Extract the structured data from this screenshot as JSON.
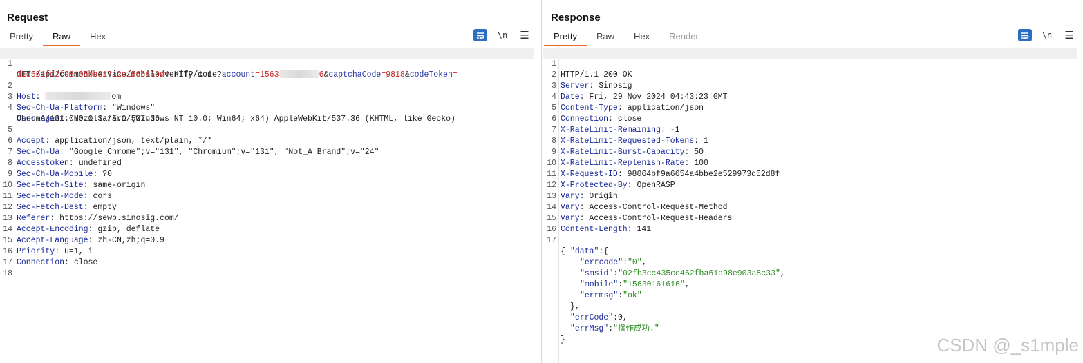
{
  "request": {
    "title": "Request",
    "tabs": [
      {
        "label": "Pretty",
        "active": false
      },
      {
        "label": "Raw",
        "active": true
      },
      {
        "label": "Hex",
        "active": false
      }
    ],
    "newline_toggle": "\\n",
    "line_numbers": [
      "1",
      "2",
      "3",
      "4",
      "5",
      "6",
      "7",
      "8",
      "9",
      "10",
      "11",
      "12",
      "13",
      "14",
      "15",
      "16",
      "17",
      "18"
    ],
    "request_line": {
      "method_path": "GET /api/common/service/mobile/verify/code?",
      "p1_key": "account",
      "p1_value_start": "=1563",
      "p1_value_end": "6",
      "amp": "&",
      "p2_key": "captchaCode",
      "p2_value": "=9818",
      "p3_key": "codeToken",
      "p3_eq": "=",
      "p3_value": "d1d561fd2f98405bb317a2c1566660d4",
      "protocol": " HTTP/1.1"
    },
    "host": {
      "name": "Host",
      "value_end": "om"
    },
    "headers": [
      {
        "name": "Sec-Ch-Ua-Platform",
        "value": "\"Windows\""
      },
      {
        "name": "User-Agent",
        "value": "Mozilla/5.0 (Windows NT 10.0; Win64; x64) AppleWebKit/537.36 (KHTML, like Gecko)",
        "cont": "Chrome/131.0.0.0 Safari/537.36"
      },
      {
        "name": "Accept",
        "value": "application/json, text/plain, */*"
      },
      {
        "name": "Sec-Ch-Ua",
        "value": "\"Google Chrome\";v=\"131\", \"Chromium\";v=\"131\", \"Not_A Brand\";v=\"24\""
      },
      {
        "name": "Accesstoken",
        "value": "undefined"
      },
      {
        "name": "Sec-Ch-Ua-Mobile",
        "value": "?0"
      },
      {
        "name": "Sec-Fetch-Site",
        "value": "same-origin"
      },
      {
        "name": "Sec-Fetch-Mode",
        "value": "cors"
      },
      {
        "name": "Sec-Fetch-Dest",
        "value": "empty"
      },
      {
        "name": "Referer",
        "value": "https://sewp.sinosig.com/"
      },
      {
        "name": "Accept-Encoding",
        "value": "gzip, deflate"
      },
      {
        "name": "Accept-Language",
        "value": "zh-CN,zh;q=0.9"
      },
      {
        "name": "Priority",
        "value": "u=1, i"
      },
      {
        "name": "Connection",
        "value": "close"
      }
    ]
  },
  "response": {
    "title": "Response",
    "tabs": [
      {
        "label": "Pretty",
        "active": true
      },
      {
        "label": "Raw",
        "active": false
      },
      {
        "label": "Hex",
        "active": false
      },
      {
        "label": "Render",
        "active": false,
        "disabled": true
      }
    ],
    "newline_toggle": "\\n",
    "line_numbers": [
      "1",
      "2",
      "3",
      "4",
      "5",
      "6",
      "7",
      "8",
      "9",
      "10",
      "11",
      "12",
      "13",
      "14",
      "15",
      "16",
      "17"
    ],
    "status_line": "HTTP/1.1 200 OK",
    "headers": [
      {
        "name": "Server",
        "value": "Sinosig"
      },
      {
        "name": "Date",
        "value": "Fri, 29 Nov 2024 04:43:23 GMT"
      },
      {
        "name": "Content-Type",
        "value": "application/json"
      },
      {
        "name": "Connection",
        "value": "close"
      },
      {
        "name": "X-RateLimit-Remaining",
        "value": "-1"
      },
      {
        "name": "X-RateLimit-Requested-Tokens",
        "value": "1"
      },
      {
        "name": "X-RateLimit-Burst-Capacity",
        "value": "50"
      },
      {
        "name": "X-RateLimit-Replenish-Rate",
        "value": "100"
      },
      {
        "name": "X-Request-ID",
        "value": "98064bf9a6654a4bbe2e529973d52d8f"
      },
      {
        "name": "X-Protected-By",
        "value": "OpenRASP"
      },
      {
        "name": "Vary",
        "value": "Origin"
      },
      {
        "name": "Vary",
        "value": "Access-Control-Request-Method"
      },
      {
        "name": "Vary",
        "value": "Access-Control-Request-Headers"
      },
      {
        "name": "Content-Length",
        "value": "141"
      }
    ],
    "body": {
      "open_brace": "{",
      "data_key": "\"data\"",
      "data_open": ":{",
      "errcode_key": "\"errcode\"",
      "errcode_val": "\"0\"",
      "smsid_key": "\"smsid\"",
      "smsid_val": "\"02fb3cc435cc462fba61d98e903a8c33\"",
      "mobile_key": "\"mobile\"",
      "mobile_val": "\"15630161616\"",
      "errmsg_key": "\"errmsg\"",
      "errmsg_val": "\"ok\"",
      "data_close": "},",
      "errCode_key": "\"errCode\"",
      "errCode_val": "0",
      "errMsg_key": "\"errMsg\"",
      "errMsg_val": "\"操作成功.\"",
      "close_brace": "}"
    }
  },
  "watermark": "CSDN @_s1mple",
  "colors": {
    "accent_tab": "#e8692c",
    "toggle_active": "#2b6fc2",
    "header_name": "#1a2a99",
    "param_value": "#c62828",
    "json_string": "#2e8b24"
  }
}
